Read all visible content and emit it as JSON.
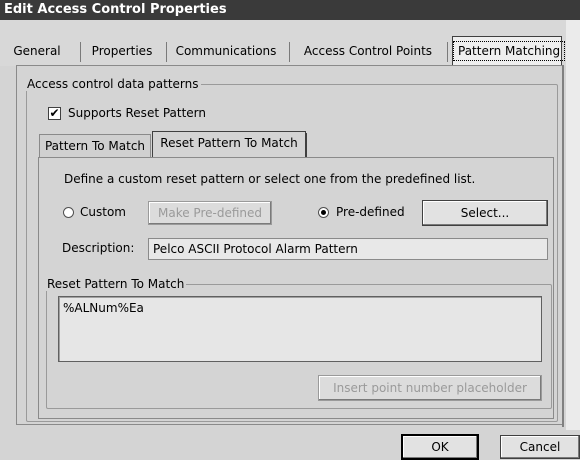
{
  "window": {
    "title": "Edit Access Control Properties"
  },
  "tabs": [
    {
      "label": "General"
    },
    {
      "label": "Properties"
    },
    {
      "label": "Communications"
    },
    {
      "label": "Access Control Points"
    },
    {
      "label": "Pattern Matching",
      "active": true
    }
  ],
  "group": {
    "legend": "Access control data patterns",
    "supports_reset": {
      "label": "Supports Reset Pattern",
      "checked": true,
      "mark": "✔"
    }
  },
  "inner_tabs": [
    {
      "label": "Pattern To Match"
    },
    {
      "label": "Reset Pattern To Match",
      "active": true
    }
  ],
  "reset": {
    "instruction": "Define a custom reset pattern or select one from the predefined list.",
    "custom_label": "Custom",
    "make_predefined_label": "Make Pre-defined",
    "predefined_label": "Pre-defined",
    "select_label": "Select...",
    "selected_mode": "Pre-defined",
    "description_label": "Description:",
    "description_value": "Pelco ASCII Protocol Alarm Pattern",
    "pattern_legend": "Reset Pattern To Match",
    "pattern_value": "%ALNum%Ea",
    "insert_placeholder_label": "Insert point number placeholder"
  },
  "footer": {
    "ok_label": "OK",
    "cancel_label": "Cancel"
  }
}
